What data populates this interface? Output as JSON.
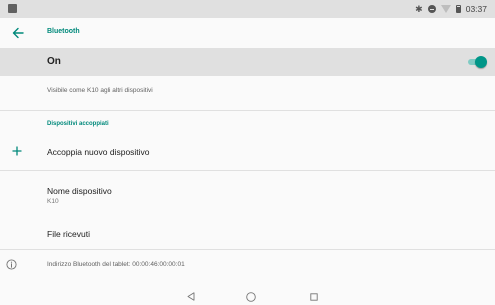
{
  "status_bar": {
    "time": "03:37",
    "icons": [
      "notification-icon",
      "bluetooth-icon",
      "do-not-disturb-icon",
      "wifi-icon",
      "battery-icon"
    ]
  },
  "app_bar": {
    "title": "Bluetooth",
    "back_icon": "arrow-back-icon"
  },
  "bluetooth_toggle": {
    "label": "On",
    "state": true
  },
  "visibility_text": "Visibile come K10 agli altri dispositivi",
  "paired_section": {
    "header": "Dispositivi accoppiati",
    "pair_new_label": "Accoppia nuovo dispositivo"
  },
  "device_name": {
    "label": "Nome dispositivo",
    "value": "K10"
  },
  "received_files": {
    "label": "File ricevuti"
  },
  "bt_address": {
    "text": "Indirizzo Bluetooth del tablet: 00:00:46:00:00:01"
  },
  "nav_bar": {
    "icons": [
      "nav-back-icon",
      "nav-home-icon",
      "nav-recents-icon"
    ]
  },
  "colors": {
    "accent": "#00897b",
    "switch_thumb": "#009688",
    "switch_track": "#80cbc4",
    "toggle_row_bg": "#e0e0e0",
    "background": "#fafafa"
  }
}
